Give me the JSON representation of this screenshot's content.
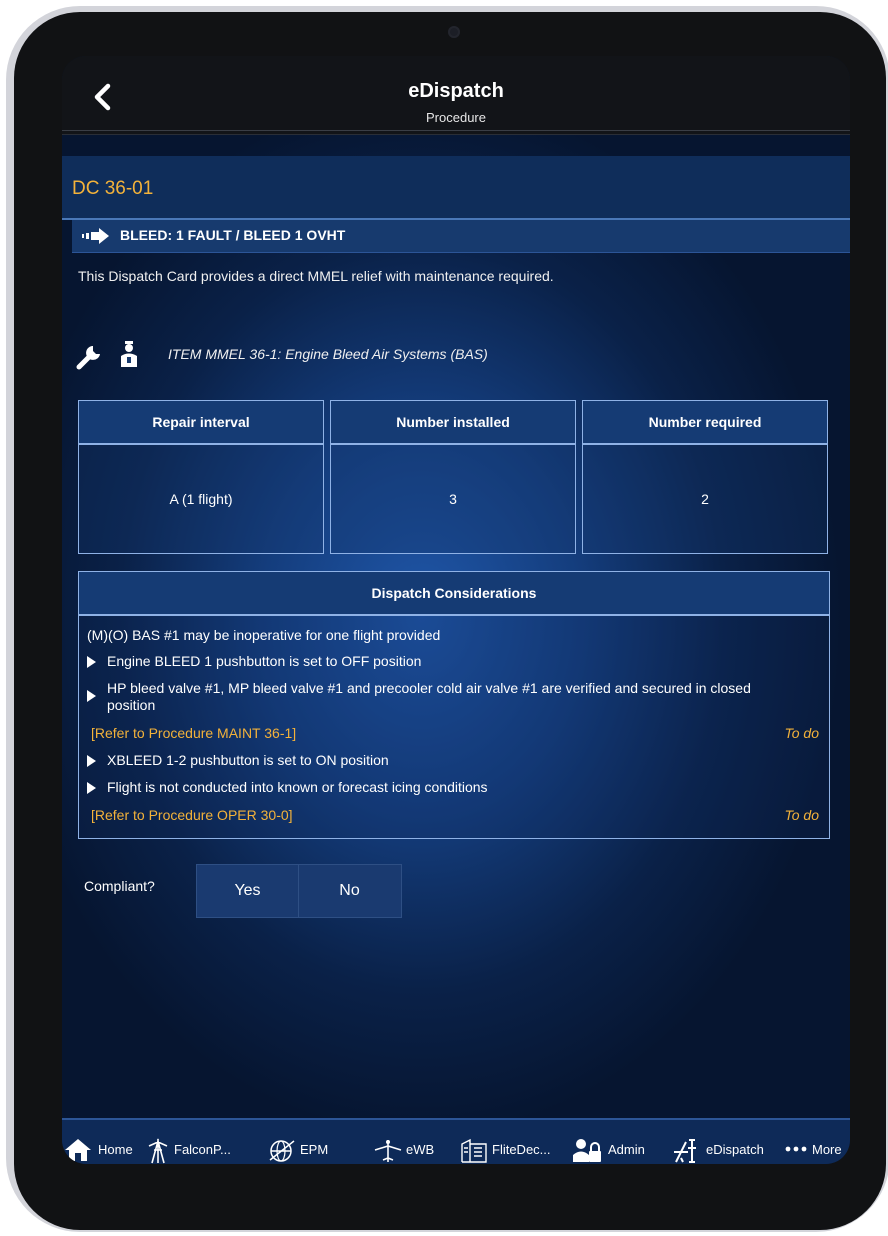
{
  "header": {
    "title": "eDispatch",
    "subtitle": "Procedure"
  },
  "card": {
    "code": "DC 36-01",
    "fault": "BLEED: 1 FAULT / BLEED 1 OVHT",
    "description": "This Dispatch Card provides a direct MMEL relief with maintenance required.",
    "item": "ITEM MMEL 36-1: Engine Bleed Air Systems (BAS)"
  },
  "table": {
    "headers": [
      "Repair interval",
      "Number installed",
      "Number required"
    ],
    "values": [
      "A (1 flight)",
      "3",
      "2"
    ]
  },
  "dispatch": {
    "title": "Dispatch Considerations",
    "intro": "(M)(O) BAS #1 may be inoperative for one flight provided",
    "bullets": [
      "Engine BLEED 1 pushbutton is set to OFF position",
      "HP bleed valve #1, MP bleed valve #1 and precooler cold air valve #1 are verified and secured in closed position",
      "XBLEED 1-2 pushbutton is set to ON position",
      "Flight is not conducted into known or forecast icing conditions"
    ],
    "refs": [
      "[Refer to Procedure MAINT 36-1]",
      "[Refer to Procedure OPER 30-0]"
    ],
    "todo": "To do"
  },
  "compliance": {
    "label": "Compliant?",
    "yes": "Yes",
    "no": "No"
  },
  "tabs": [
    {
      "label": "Home",
      "icon": "home-icon"
    },
    {
      "label": "FalconP...",
      "icon": "tower-icon"
    },
    {
      "label": "EPM",
      "icon": "globe-icon"
    },
    {
      "label": "eWB",
      "icon": "aircraft-icon"
    },
    {
      "label": "FliteDec...",
      "icon": "flight-deck-icon"
    },
    {
      "label": "Admin",
      "icon": "admin-icon"
    },
    {
      "label": "eDispatch",
      "icon": "dispatch-icon"
    },
    {
      "label": "More",
      "icon": "more-icon"
    }
  ],
  "colors": {
    "accent": "#f3b23a",
    "tabbar": "#0e2a58",
    "border": "#8fb2e6"
  }
}
